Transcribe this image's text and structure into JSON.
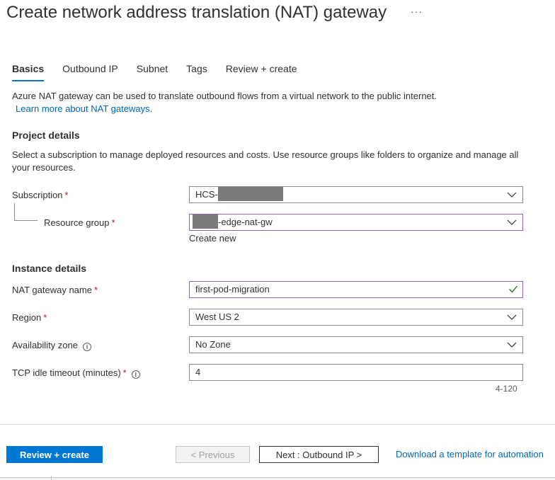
{
  "header": {
    "title": "Create network address translation (NAT) gateway",
    "more_label": "···"
  },
  "tabs": [
    {
      "label": "Basics",
      "active": true
    },
    {
      "label": "Outbound IP",
      "active": false
    },
    {
      "label": "Subnet",
      "active": false
    },
    {
      "label": "Tags",
      "active": false
    },
    {
      "label": "Review + create",
      "active": false
    }
  ],
  "intro": {
    "text": "Azure NAT gateway can be used to translate outbound flows from a virtual network to the public internet.",
    "link": "Learn more about NAT gateways."
  },
  "project_details": {
    "title": "Project details",
    "description": "Select a subscription to manage deployed resources and costs. Use resource groups like folders to organize and manage all your resources.",
    "subscription": {
      "label": "Subscription",
      "value": "HCS-"
    },
    "resource_group": {
      "label": "Resource group",
      "value": "-edge-nat-gw",
      "create_new": "Create new"
    }
  },
  "instance_details": {
    "title": "Instance details",
    "name": {
      "label": "NAT gateway name",
      "value": "first-pod-migration"
    },
    "region": {
      "label": "Region",
      "value": "West US 2"
    },
    "zone": {
      "label": "Availability zone",
      "value": "No Zone"
    },
    "timeout": {
      "label": "TCP idle timeout (minutes)",
      "value": "4",
      "range_hint": "4-120"
    }
  },
  "required_marker": "*",
  "info_glyph": "i",
  "footer": {
    "review_create": "Review + create",
    "previous": "< Previous",
    "next": "Next : Outbound IP >",
    "download": "Download a template for automation"
  },
  "colors": {
    "accent": "#0078d4",
    "link": "#0067b8",
    "required": "#a4262c",
    "focus_border": "#8764b8",
    "valid_check": "#107c10"
  }
}
